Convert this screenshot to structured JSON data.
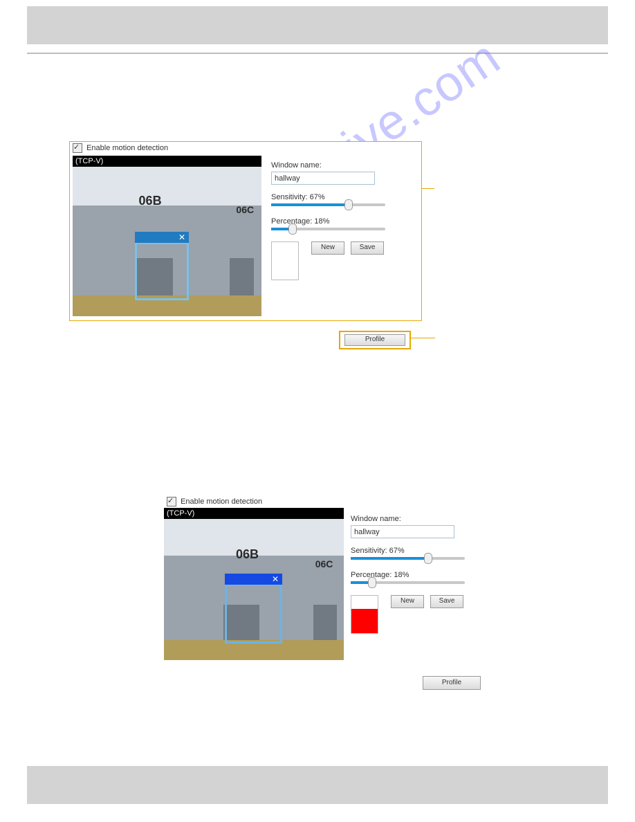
{
  "watermark": "manualshive.com",
  "panel1": {
    "enable_label": "Enable motion detection",
    "video_title": "(TCP-V)",
    "sign1": "06B",
    "sign2": "06C",
    "window_name_label": "Window name:",
    "window_name_value": "hallway",
    "sensitivity_label": "Sensitivity: 67%",
    "sensitivity_pct": 67,
    "percentage_label": "Percentage: 18%",
    "percentage_pct": 18,
    "new_label": "New",
    "save_label": "Save",
    "profile_label": "Profile",
    "indicator_fill_pct": 0
  },
  "panel2": {
    "enable_label": "Enable motion detection",
    "video_title": "(TCP-V)",
    "sign1": "06B",
    "sign2": "06C",
    "window_name_label": "Window name:",
    "window_name_value": "hallway",
    "sensitivity_label": "Sensitivity: 67%",
    "sensitivity_pct": 67,
    "percentage_label": "Percentage: 18%",
    "percentage_pct": 18,
    "new_label": "New",
    "save_label": "Save",
    "profile_label": "Profile",
    "indicator_fill_pct": 65
  }
}
